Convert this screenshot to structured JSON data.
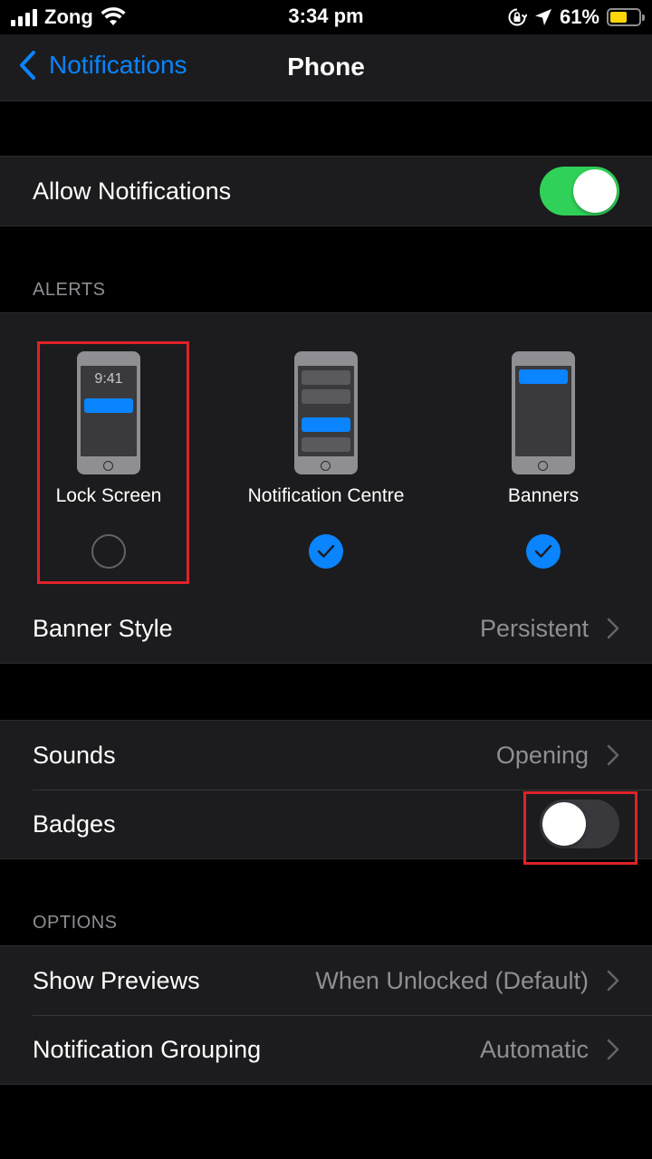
{
  "status_bar": {
    "carrier": "Zong",
    "time": "3:34 pm",
    "battery_percent": "61%",
    "battery_level": 0.61,
    "battery_color": "#ffd60a"
  },
  "nav": {
    "back_label": "Notifications",
    "title": "Phone"
  },
  "allow_notifications": {
    "label": "Allow Notifications",
    "enabled": true
  },
  "alerts": {
    "header": "ALERTS",
    "lock_screen": {
      "label": "Lock Screen",
      "mock_time": "9:41",
      "selected": false
    },
    "notification_centre": {
      "label": "Notification Centre",
      "selected": true
    },
    "banners": {
      "label": "Banners",
      "selected": true
    },
    "banner_style": {
      "label": "Banner Style",
      "value": "Persistent"
    }
  },
  "sounds_group": {
    "sounds": {
      "label": "Sounds",
      "value": "Opening"
    },
    "badges": {
      "label": "Badges",
      "enabled": false
    }
  },
  "options": {
    "header": "OPTIONS",
    "show_previews": {
      "label": "Show Previews",
      "value": "When Unlocked (Default)"
    },
    "notification_grouping": {
      "label": "Notification Grouping",
      "value": "Automatic"
    }
  },
  "colors": {
    "accent": "#0a84ff",
    "toggle_on": "#30d158",
    "highlight": "#e02229"
  }
}
